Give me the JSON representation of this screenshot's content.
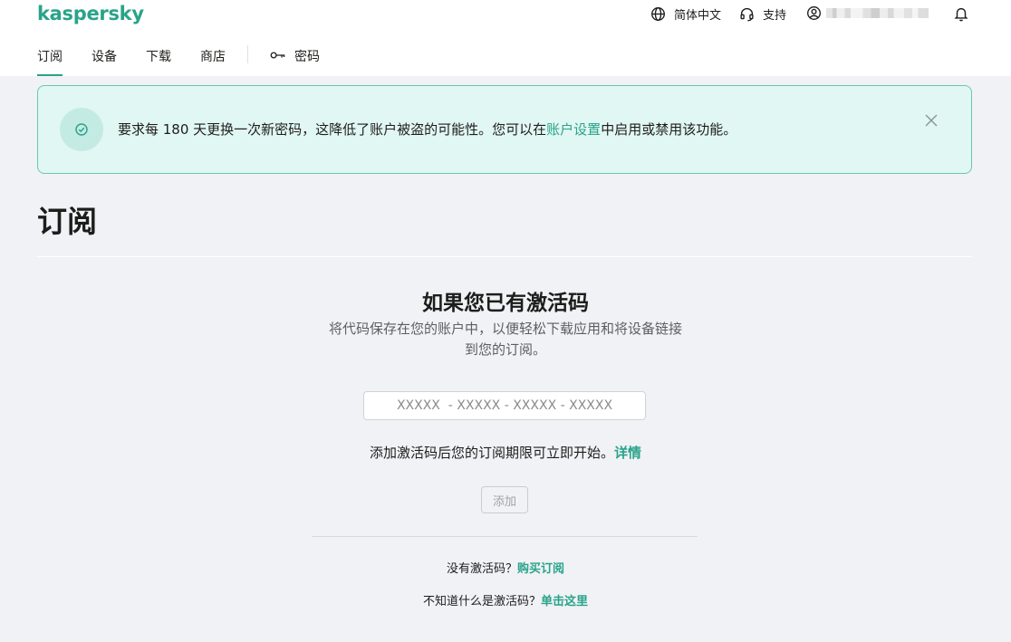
{
  "brand": {
    "logo_text": "kaspersky",
    "accent": "#29a38a"
  },
  "header": {
    "language": {
      "label": "简体中文",
      "icon": "globe-icon"
    },
    "support": {
      "label": "支持",
      "icon": "headset-icon"
    },
    "account": {
      "icon": "user-circle-icon"
    },
    "notifications": {
      "icon": "bell-icon"
    }
  },
  "nav": {
    "items": [
      {
        "label": "订阅",
        "active": true
      },
      {
        "label": "设备"
      },
      {
        "label": "下载"
      },
      {
        "label": "商店"
      }
    ],
    "password": {
      "label": "密码",
      "icon": "key-icon"
    }
  },
  "banner": {
    "icon": "check-circle-icon",
    "text_before": "要求每 180 天更换一次新密码，这降低了账户被盗的可能性。您可以在",
    "link_text": "账户设置",
    "text_after": "中启用或禁用该功能。",
    "close_icon": "close-icon"
  },
  "page": {
    "title": "订阅"
  },
  "activation": {
    "heading": "如果您已有激活码",
    "description_line1": "将代码保存在您的账户中，以便轻松下载应用和将设备链接",
    "description_line2": "到您的订阅。",
    "input_placeholder": "XXXXX  - XXXXX - XXXXX - XXXXX",
    "input_value": "",
    "start_text": "添加激活码后您的订阅期限可立即开始。",
    "details_link": "详情",
    "add_button": "添加",
    "no_code_text": "没有激活码？",
    "buy_link": "购买订阅",
    "what_text": "不知道什么是激活码？",
    "click_here_link": "单击这里"
  }
}
